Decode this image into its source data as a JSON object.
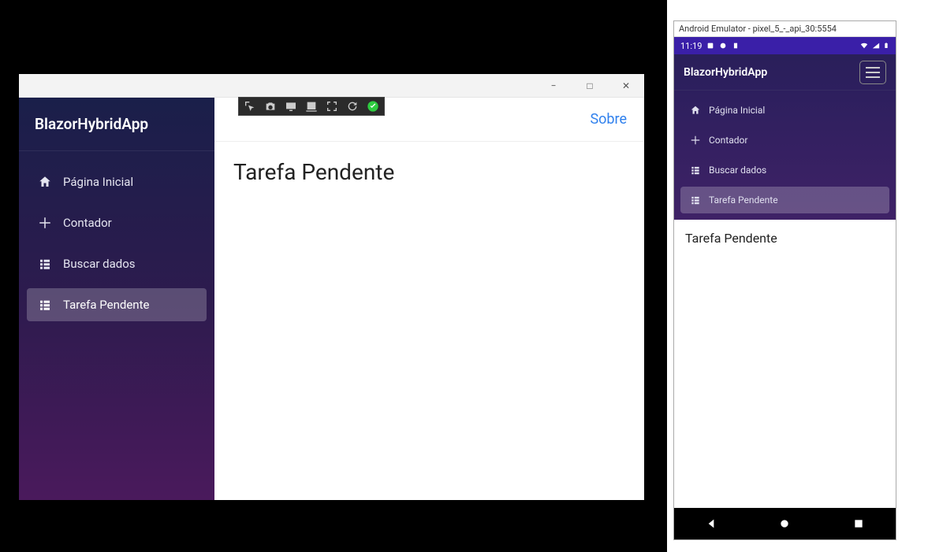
{
  "desktop": {
    "brand": "BlazorHybridApp",
    "nav": [
      {
        "label": "Página Inicial",
        "icon": "home"
      },
      {
        "label": "Contador",
        "icon": "plus"
      },
      {
        "label": "Buscar dados",
        "icon": "list"
      },
      {
        "label": "Tarefa Pendente",
        "icon": "list"
      }
    ],
    "active_nav_index": 3,
    "topbar": {
      "about_label": "Sobre"
    },
    "page_title": "Tarefa Pendente",
    "titlebar": {
      "minimize": "−",
      "maximize": "□",
      "close": "✕"
    }
  },
  "emulator": {
    "window_title": "Android Emulator - pixel_5_-_api_30:5554",
    "status": {
      "time": "11:19"
    },
    "brand": "BlazorHybridApp",
    "nav": [
      {
        "label": "Página Inicial",
        "icon": "home"
      },
      {
        "label": "Contador",
        "icon": "plus"
      },
      {
        "label": "Buscar dados",
        "icon": "list"
      },
      {
        "label": "Tarefa Pendente",
        "icon": "list"
      }
    ],
    "active_nav_index": 3,
    "page_title": "Tarefa Pendente"
  }
}
